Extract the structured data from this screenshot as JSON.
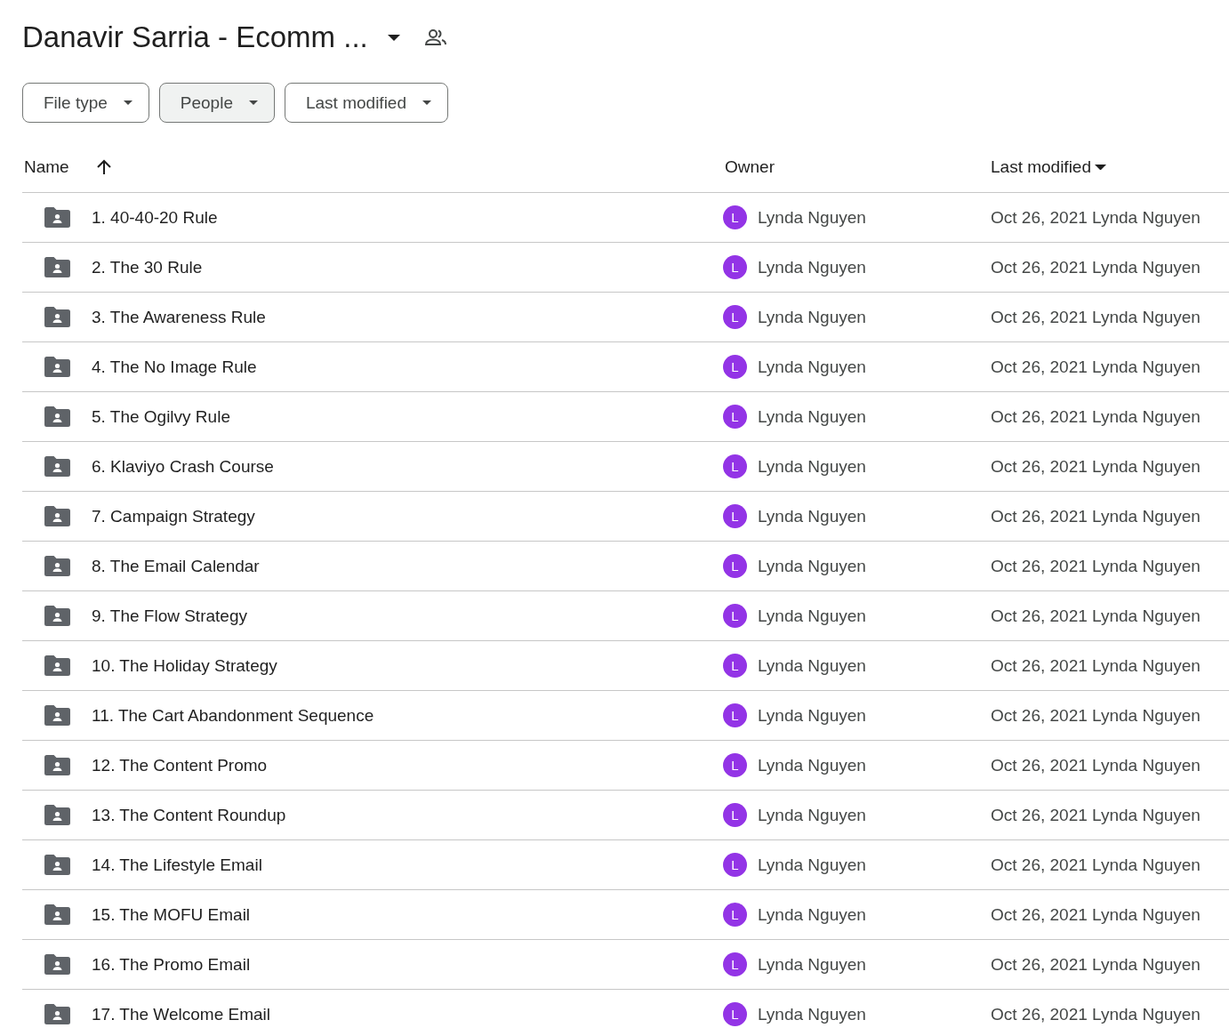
{
  "title": "Danavir Sarria - Ecomm ...",
  "filters": [
    {
      "label": "File type",
      "selected": false
    },
    {
      "label": "People",
      "selected": true
    },
    {
      "label": "Last modified",
      "selected": false
    }
  ],
  "columns": [
    "Name",
    "Owner",
    "Last modified"
  ],
  "rows": [
    {
      "name": "1. 40-40-20 Rule",
      "avatar": "L",
      "owner": "Lynda Nguyen",
      "modified": "Oct 26, 2021 Lynda Nguyen"
    },
    {
      "name": "2. The 30 Rule",
      "avatar": "L",
      "owner": "Lynda Nguyen",
      "modified": "Oct 26, 2021 Lynda Nguyen"
    },
    {
      "name": "3. The Awareness Rule",
      "avatar": "L",
      "owner": "Lynda Nguyen",
      "modified": "Oct 26, 2021 Lynda Nguyen"
    },
    {
      "name": "4. The No Image Rule",
      "avatar": "L",
      "owner": "Lynda Nguyen",
      "modified": "Oct 26, 2021 Lynda Nguyen"
    },
    {
      "name": "5. The Ogilvy Rule",
      "avatar": "L",
      "owner": "Lynda Nguyen",
      "modified": "Oct 26, 2021 Lynda Nguyen"
    },
    {
      "name": "6. Klaviyo Crash Course",
      "avatar": "L",
      "owner": "Lynda Nguyen",
      "modified": "Oct 26, 2021 Lynda Nguyen"
    },
    {
      "name": "7. Campaign Strategy",
      "avatar": "L",
      "owner": "Lynda Nguyen",
      "modified": "Oct 26, 2021 Lynda Nguyen"
    },
    {
      "name": "8. The Email Calendar",
      "avatar": "L",
      "owner": "Lynda Nguyen",
      "modified": "Oct 26, 2021 Lynda Nguyen"
    },
    {
      "name": "9. The Flow Strategy",
      "avatar": "L",
      "owner": "Lynda Nguyen",
      "modified": "Oct 26, 2021 Lynda Nguyen"
    },
    {
      "name": "10. The Holiday Strategy",
      "avatar": "L",
      "owner": "Lynda Nguyen",
      "modified": "Oct 26, 2021 Lynda Nguyen"
    },
    {
      "name": "11. The Cart Abandonment Sequence",
      "avatar": "L",
      "owner": "Lynda Nguyen",
      "modified": "Oct 26, 2021 Lynda Nguyen"
    },
    {
      "name": "12. The Content Promo",
      "avatar": "L",
      "owner": "Lynda Nguyen",
      "modified": "Oct 26, 2021 Lynda Nguyen"
    },
    {
      "name": "13. The Content Roundup",
      "avatar": "L",
      "owner": "Lynda Nguyen",
      "modified": "Oct 26, 2021 Lynda Nguyen"
    },
    {
      "name": "14. The Lifestyle Email",
      "avatar": "L",
      "owner": "Lynda Nguyen",
      "modified": "Oct 26, 2021 Lynda Nguyen"
    },
    {
      "name": "15. The MOFU Email",
      "avatar": "L",
      "owner": "Lynda Nguyen",
      "modified": "Oct 26, 2021 Lynda Nguyen"
    },
    {
      "name": "16. The Promo Email",
      "avatar": "L",
      "owner": "Lynda Nguyen",
      "modified": "Oct 26, 2021 Lynda Nguyen"
    },
    {
      "name": "17. The Welcome Email",
      "avatar": "L",
      "owner": "Lynda Nguyen",
      "modified": "Oct 26, 2021 Lynda Nguyen"
    }
  ]
}
